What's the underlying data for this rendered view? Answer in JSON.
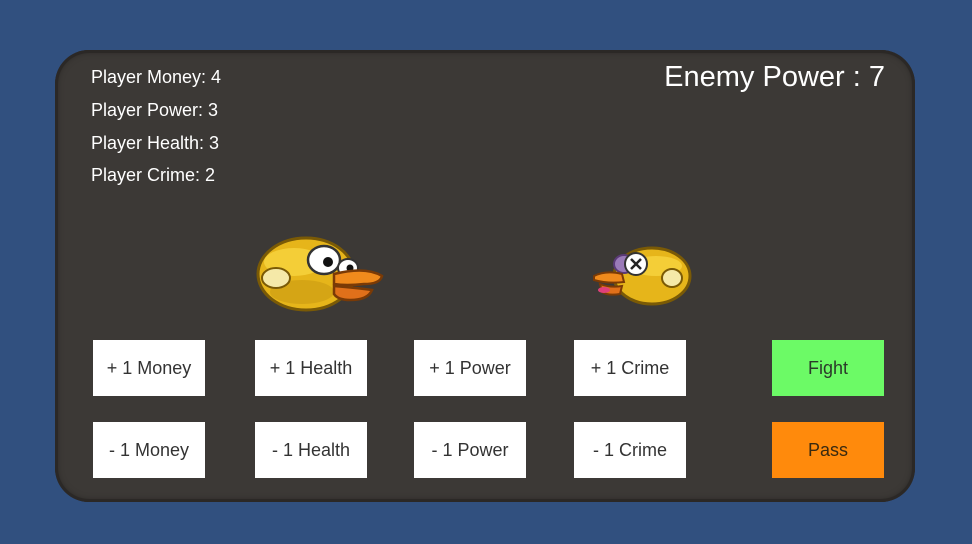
{
  "player": {
    "money_label": "Player Money: 4",
    "power_label": "Player Power: 3",
    "health_label": "Player Health: 3",
    "crime_label": "Player Crime: 2",
    "money": 4,
    "power": 3,
    "health": 3,
    "crime": 2
  },
  "enemy": {
    "power_label": "Enemy Power : 7",
    "power": 7
  },
  "buttons": {
    "add_money": "+ 1 Money",
    "add_health": "+ 1 Health",
    "add_power": "+ 1 Power",
    "add_crime": "+ 1 Crime",
    "sub_money": "- 1 Money",
    "sub_health": "- 1 Health",
    "sub_power": "- 1 Power",
    "sub_crime": "- 1 Crime",
    "fight": "Fight",
    "pass": "Pass"
  },
  "icons": {
    "player": "yellow-bird-icon",
    "enemy": "dead-bird-icon"
  },
  "colors": {
    "background": "#31507f",
    "panel": "#3c3936",
    "fight": "#6cfa66",
    "pass": "#ff8a0c"
  }
}
